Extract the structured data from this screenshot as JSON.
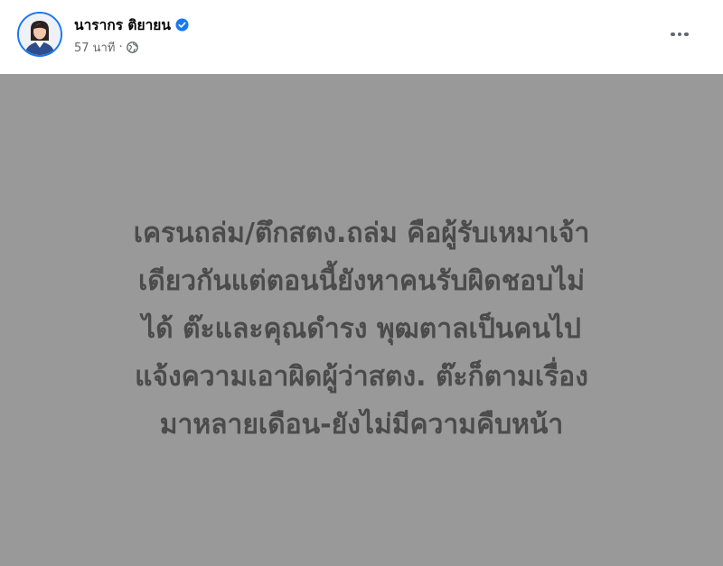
{
  "post": {
    "author_name": "นารากร ติยายน",
    "verified_icon": "verified-badge-icon",
    "timestamp": "57 นาที",
    "separator": "·",
    "audience_icon": "globe-icon",
    "more_icon": "more-options-icon",
    "text_lines": [
      "เครนถล่ม/ตึกสตง.ถล่ม คือผู้รับเหมาเจ้า",
      "เดียวกันแต่ตอนนี้ยังหาคนรับผิดชอบไม่",
      "ได้ ต๊ะและคุณดำรง พุฒตาลเป็นคนไป",
      "แจ้งความเอาผิดผู้ว่าสตง. ต๊ะก็ตามเรื่อง",
      "มาหลายเดือน-ยังไม่มีความคืบหน้า"
    ],
    "background_color": "#999999",
    "text_color": "#4b4b4b",
    "accent_color": "#1877f2"
  }
}
